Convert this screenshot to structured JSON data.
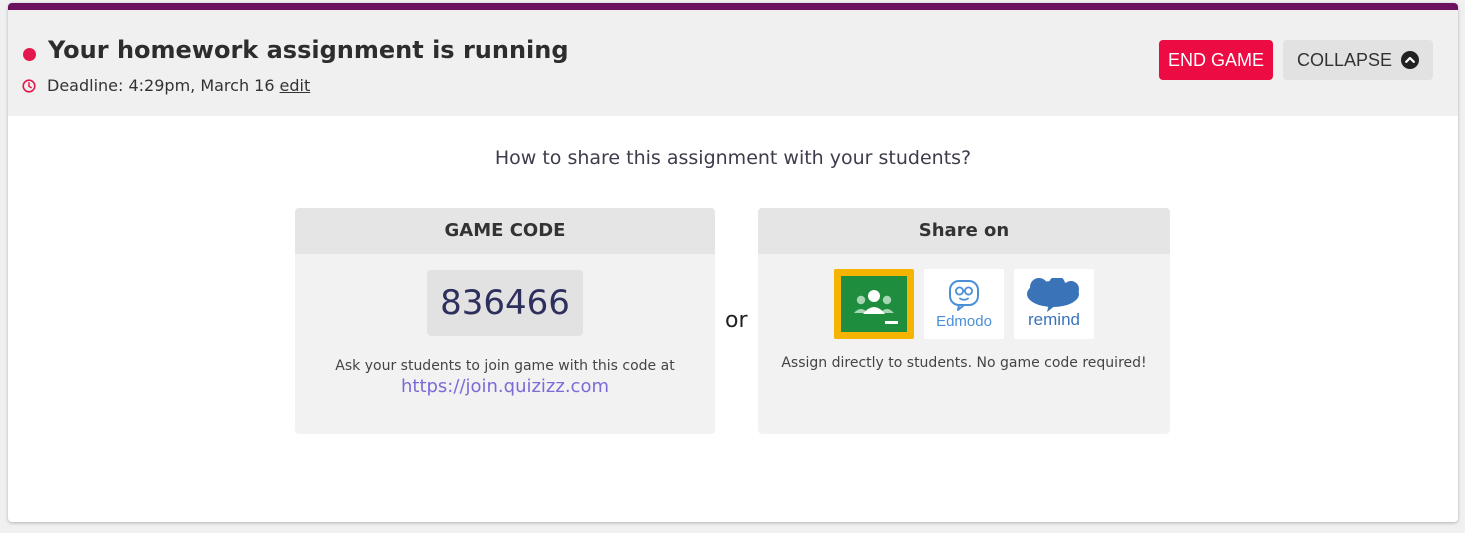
{
  "header": {
    "title": "Your homework assignment is running",
    "deadline_label": "Deadline: 4:29pm, March 16",
    "edit_label": "edit",
    "end_game_label": "END GAME",
    "collapse_label": "COLLAPSE"
  },
  "share": {
    "prompt": "How to share this assignment with your students?",
    "game_code_heading": "GAME CODE",
    "game_code": "836466",
    "instructions": "Ask your students to join game with this code at",
    "join_url": "https://join.quizizz.com",
    "or_label": "or",
    "share_on_heading": "Share on",
    "platforms": [
      "Google Classroom",
      "Edmodo",
      "Remind"
    ],
    "edmodo_label": "Edmodo",
    "remind_label": "remind",
    "assign_text": "Assign directly to students. No game code required!"
  },
  "colors": {
    "accent_purple": "#6b1160",
    "end_game_red": "#ec0b43",
    "link_purple": "#7b6bd6",
    "google_classroom_yellow": "#f4b400",
    "google_classroom_green": "#1e8e3e",
    "edmodo_blue": "#4a90d9",
    "remind_blue": "#3b73b9"
  },
  "icons": {
    "status": "status-dot-icon",
    "deadline": "clock-icon",
    "collapse": "chevron-up-circle-icon",
    "google_classroom": "google-classroom-icon",
    "edmodo": "edmodo-icon",
    "remind": "remind-icon"
  }
}
